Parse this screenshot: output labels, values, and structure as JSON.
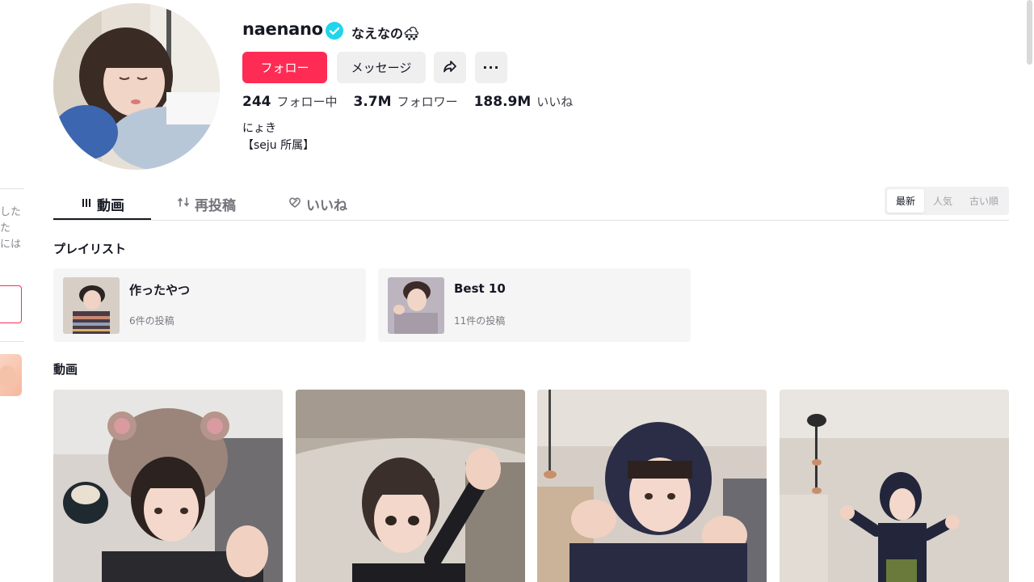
{
  "sidebar_fragment": {
    "text_lines": [
      "した",
      "た",
      "には"
    ]
  },
  "profile": {
    "username": "naenano",
    "nickname": "なえなの🌨",
    "verified": true,
    "buttons": {
      "follow": "フォロー",
      "message": "メッセージ",
      "share_icon": "share-icon",
      "more": "···"
    },
    "stats": [
      {
        "value": "244",
        "label": "フォロー中"
      },
      {
        "value": "3.7M",
        "label": "フォロワー"
      },
      {
        "value": "188.9M",
        "label": "いいね"
      }
    ],
    "bio": [
      "にょき",
      "【seju 所属】"
    ]
  },
  "tabs": [
    {
      "label": "動画",
      "icon": "grid-icon",
      "active": true
    },
    {
      "label": "再投稿",
      "icon": "repost-icon",
      "active": false
    },
    {
      "label": "いいね",
      "icon": "heart-icon",
      "active": false
    }
  ],
  "sort_options": [
    {
      "label": "最新",
      "active": true
    },
    {
      "label": "人気",
      "active": false
    },
    {
      "label": "古い順",
      "active": false
    }
  ],
  "playlists": {
    "title": "プレイリスト",
    "items": [
      {
        "name": "作ったやつ",
        "count": "6件の投稿"
      },
      {
        "name": "Best 10",
        "count": "11件の投稿"
      }
    ]
  },
  "videos": {
    "title": "動画",
    "count_visible": 4
  },
  "colors": {
    "accent": "#fe2c55",
    "verified": "#20d5ec",
    "text": "#161823",
    "muted": "#73747b"
  }
}
